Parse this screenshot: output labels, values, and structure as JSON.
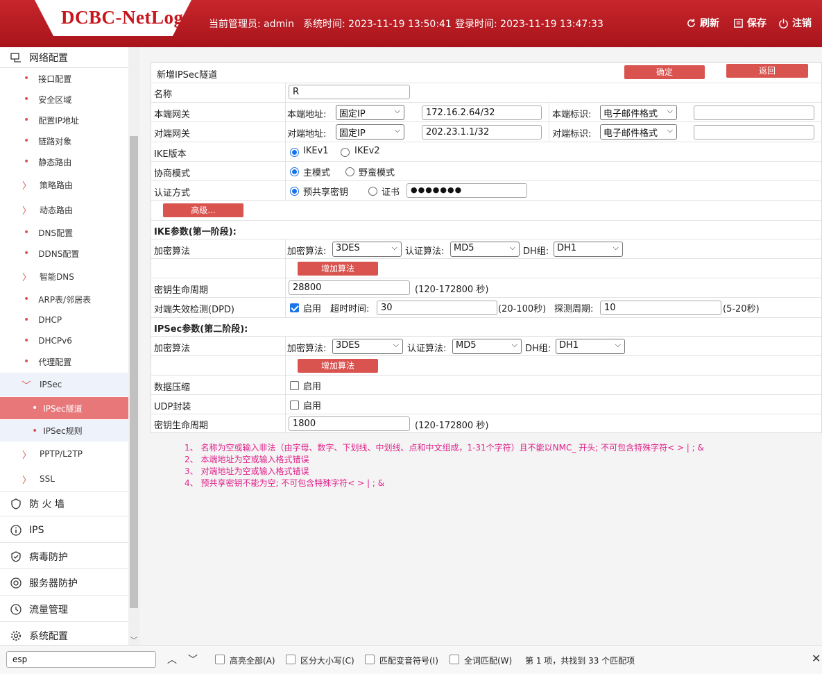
{
  "header": {
    "logo": "DCBC-NetLog",
    "admin_label": "当前管理员: admin",
    "system_time": "系统时间: 2023-11-19 13:50:41",
    "login_time": "登录时间: 2023-11-19 13:47:33",
    "refresh": "刷新",
    "save": "保存",
    "logout": "注销"
  },
  "sidebar": {
    "network_config": "网络配置",
    "items": {
      "interface": "接口配置",
      "security_zone": "安全区域",
      "config_ip": "配置IP地址",
      "link_object": "链路对象",
      "static_route": "静态路由",
      "policy_route": "策略路由",
      "dynamic_route": "动态路由",
      "dns": "DNS配置",
      "ddns": "DDNS配置",
      "smart_dns": "智能DNS",
      "arp": "ARP表/邻居表",
      "dhcp": "DHCP",
      "dhcpv6": "DHCPv6",
      "proxy": "代理配置",
      "ipsec": "IPSec",
      "ipsec_tunnel": "IPSec隧道",
      "ipsec_rule": "IPSec规则",
      "pptp": "PPTP/L2TP",
      "ssl": "SSL"
    },
    "groups": {
      "firewall": "防 火 墙",
      "ips": "IPS",
      "antivirus": "病毒防护",
      "server_protect": "服务器防护",
      "traffic": "流量管理",
      "system": "系统配置"
    }
  },
  "form": {
    "title": "新增IPSec隧道",
    "ok": "确定",
    "back": "返回",
    "name_label": "名称",
    "name_value": "R",
    "local_gw_label": "本端网关",
    "local_addr_label": "本端地址:",
    "local_addr_type": "固定IP",
    "local_addr_value": "172.16.2.64/32",
    "local_id_label": "本端标识:",
    "local_id_type": "电子邮件格式",
    "local_id_value": "",
    "peer_gw_label": "对端网关",
    "peer_addr_label": "对端地址:",
    "peer_addr_type": "固定IP",
    "peer_addr_value": "202.23.1.1/32",
    "peer_id_label": "对端标识:",
    "peer_id_type": "电子邮件格式",
    "peer_id_value": "",
    "ike_version_label": "IKE版本",
    "ikev1": "IKEv1",
    "ikev2": "IKEv2",
    "nego_mode_label": "协商模式",
    "main_mode": "主模式",
    "aggressive_mode": "野蛮模式",
    "auth_label": "认证方式",
    "psk": "预共享密钥",
    "cert": "证书",
    "psk_value": "●●●●●●●",
    "advanced": "高级...",
    "ike_section": "IKE参数(第一阶段):",
    "enc_algo_label": "加密算法",
    "enc_label": "加密算法:",
    "ike_enc": "3DES",
    "auth_algo_label": "认证算法:",
    "ike_auth": "MD5",
    "dh_label": "DH组:",
    "ike_dh": "DH1",
    "add_algo": "增加算法",
    "key_life_label": "密钥生命周期",
    "ike_life": "28800",
    "life_range": "(120-172800 秒)",
    "dpd_label": "对端失效检测(DPD)",
    "enable": "启用",
    "timeout_label": "超时时间:",
    "timeout_value": "30",
    "timeout_range": "(20-100秒)",
    "probe_label": "探测周期:",
    "probe_value": "10",
    "probe_range": "(5-20秒)",
    "ipsec_section": "IPSec参数(第二阶段):",
    "ipsec_enc": "3DES",
    "ipsec_auth": "MD5",
    "ipsec_dh": "DH1",
    "compress_label": "数据压缩",
    "udp_label": "UDP封装",
    "ipsec_life": "1800"
  },
  "errors": [
    "1、 名称为空或输入非法（由字母、数字、下划线、中划线、点和中文组成，1-31个字符）且不能以NMC_ 开头; 不可包含特殊字符< > | ; &",
    "2、 本端地址为空或输入格式错误",
    "3、 对端地址为空或输入格式错误",
    "4、 预共享密钥不能为空; 不可包含特殊字符< > | ; &"
  ],
  "findbar": {
    "query": "esp",
    "highlight_all": "高亮全部(A)",
    "match_case": "区分大小写(C)",
    "match_diacritics": "匹配变音符号(I)",
    "whole_words": "全词匹配(W)",
    "status": "第 1 项，共找到 33 个匹配项"
  },
  "colors": {
    "header": "#b81c22",
    "accent": "#d9534f",
    "active_item": "#e8777a",
    "error": "#e0218a"
  }
}
